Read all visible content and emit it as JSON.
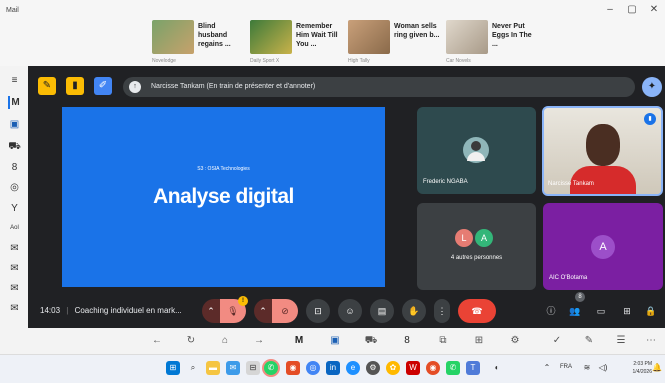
{
  "window": {
    "title": "Mail",
    "minimize": "–",
    "maximize": "▢",
    "close": "✕"
  },
  "news": [
    {
      "title": "Blind husband regains ...",
      "source": "Novelodge"
    },
    {
      "title": "Remember Him Wait Till You ...",
      "source": "Daily Sport X"
    },
    {
      "title": "Woman sells ring given b...",
      "source": "High Tally"
    },
    {
      "title": "Never Put Eggs In The ...",
      "source": "Car Novels"
    }
  ],
  "meet": {
    "presenter_text": "Narcisse Tankam (En train de présenter et d'annoter)",
    "slide": {
      "subtitle": "S3 : OSIA Technologies",
      "title": "Analyse digital"
    },
    "tiles": [
      {
        "name": "Frederic NGABA"
      },
      {
        "name": "Narcisse Tankam"
      },
      {
        "name": "4 autres personnes",
        "initials": [
          "L",
          "A"
        ]
      },
      {
        "name": "AIC O'Botama",
        "initial": "A"
      }
    ],
    "time": "14:03",
    "meeting_name": "Coaching individuel en mark...",
    "mic_badge": "!",
    "people_count": "8"
  },
  "taskbar": {
    "lang": "FRA",
    "time": "2:03 PM",
    "date": "1/4/2026"
  },
  "colors": {
    "meet_bg": "#202124",
    "slide_blue": "#1a73e8",
    "end_call": "#ea4335",
    "mic_off": "#f28b82",
    "purple_tile": "#7b1fa2"
  }
}
